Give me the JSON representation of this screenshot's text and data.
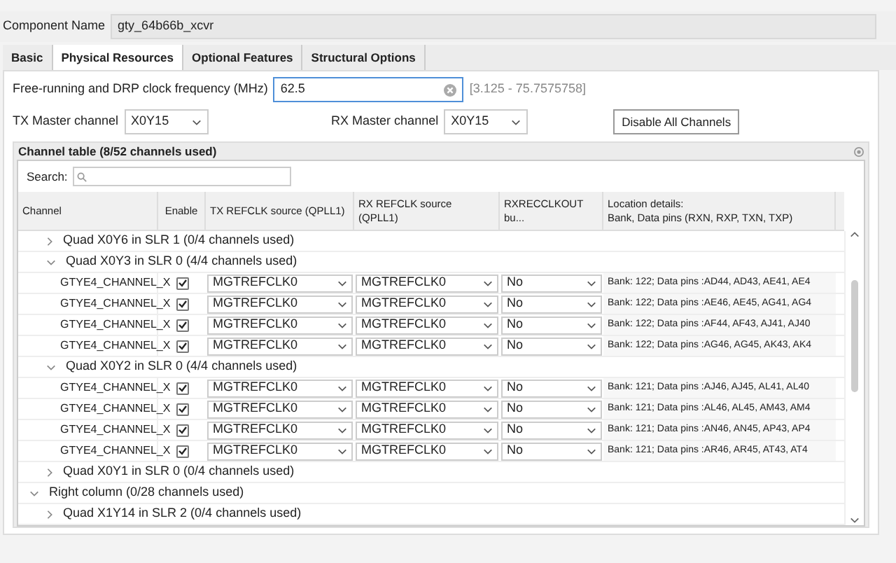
{
  "component": {
    "label": "Component Name",
    "value": "gty_64b66b_xcvr"
  },
  "tabs": [
    {
      "label": "Basic",
      "selected": false
    },
    {
      "label": "Physical Resources",
      "selected": true
    },
    {
      "label": "Optional Features",
      "selected": false
    },
    {
      "label": "Structural Options",
      "selected": false
    }
  ],
  "clock": {
    "label": "Free-running and DRP clock frequency (MHz)",
    "value": "62.5",
    "range": "[3.125 - 75.7575758]"
  },
  "tx_master": {
    "label": "TX Master channel",
    "value": "X0Y15"
  },
  "rx_master": {
    "label": "RX Master channel",
    "value": "X0Y15"
  },
  "disable_button": "Disable All Channels",
  "channel_table": {
    "title": "Channel table (8/52 channels used)",
    "search_label": "Search:",
    "columns": [
      "Channel",
      "Enable",
      "TX REFCLK source (QPLL1)",
      "RX REFCLK source (QPLL1)",
      "RXRECCLKOUT bu...",
      "Location details:\nBank, Data pins (RXN, RXP, TXN, TXP)"
    ],
    "tree": [
      {
        "kind": "quad",
        "label": "Quad X0Y6 in SLR 1 (0/4 channels used)",
        "expanded": false
      },
      {
        "kind": "quad",
        "label": "Quad X0Y3 in SLR 0 (4/4 channels used)",
        "expanded": true,
        "children": [
          {
            "kind": "channel",
            "name": "GTYE4_CHANNEL_X",
            "enabled": true,
            "tx": "MGTREFCLK0",
            "rx": "MGTREFCLK0",
            "rxrec": "No",
            "location": "Bank: 122; Data pins :AD44, AD43, AE41, AE4"
          },
          {
            "kind": "channel",
            "name": "GTYE4_CHANNEL_X",
            "enabled": true,
            "tx": "MGTREFCLK0",
            "rx": "MGTREFCLK0",
            "rxrec": "No",
            "location": "Bank: 122; Data pins :AE46, AE45, AG41, AG4"
          },
          {
            "kind": "channel",
            "name": "GTYE4_CHANNEL_X",
            "enabled": true,
            "tx": "MGTREFCLK0",
            "rx": "MGTREFCLK0",
            "rxrec": "No",
            "location": "Bank: 122; Data pins :AF44, AF43, AJ41, AJ40"
          },
          {
            "kind": "channel",
            "name": "GTYE4_CHANNEL_X",
            "enabled": true,
            "tx": "MGTREFCLK0",
            "rx": "MGTREFCLK0",
            "rxrec": "No",
            "location": "Bank: 122; Data pins :AG46, AG45, AK43, AK4"
          }
        ]
      },
      {
        "kind": "quad",
        "label": "Quad X0Y2 in SLR 0 (4/4 channels used)",
        "expanded": true,
        "children": [
          {
            "kind": "channel",
            "name": "GTYE4_CHANNEL_X",
            "enabled": true,
            "tx": "MGTREFCLK0",
            "rx": "MGTREFCLK0",
            "rxrec": "No",
            "location": "Bank: 121; Data pins :AJ46, AJ45, AL41, AL40"
          },
          {
            "kind": "channel",
            "name": "GTYE4_CHANNEL_X",
            "enabled": true,
            "tx": "MGTREFCLK0",
            "rx": "MGTREFCLK0",
            "rxrec": "No",
            "location": "Bank: 121; Data pins :AL46, AL45, AM43, AM4"
          },
          {
            "kind": "channel",
            "name": "GTYE4_CHANNEL_X",
            "enabled": true,
            "tx": "MGTREFCLK0",
            "rx": "MGTREFCLK0",
            "rxrec": "No",
            "location": "Bank: 121; Data pins :AN46, AN45, AP43, AP4"
          },
          {
            "kind": "channel",
            "name": "GTYE4_CHANNEL_X",
            "enabled": true,
            "tx": "MGTREFCLK0",
            "rx": "MGTREFCLK0",
            "rxrec": "No",
            "location": "Bank: 121; Data pins :AR46, AR45, AT43, AT4"
          }
        ]
      },
      {
        "kind": "quad",
        "label": "Quad X0Y1 in SLR 0 (0/4 channels used)",
        "expanded": false
      },
      {
        "kind": "column",
        "label": "Right column (0/28 channels used)",
        "expanded": true,
        "children": [
          {
            "kind": "quad",
            "label": "Quad X1Y14 in SLR 2 (0/4 channels used)",
            "expanded": false
          }
        ]
      }
    ]
  }
}
